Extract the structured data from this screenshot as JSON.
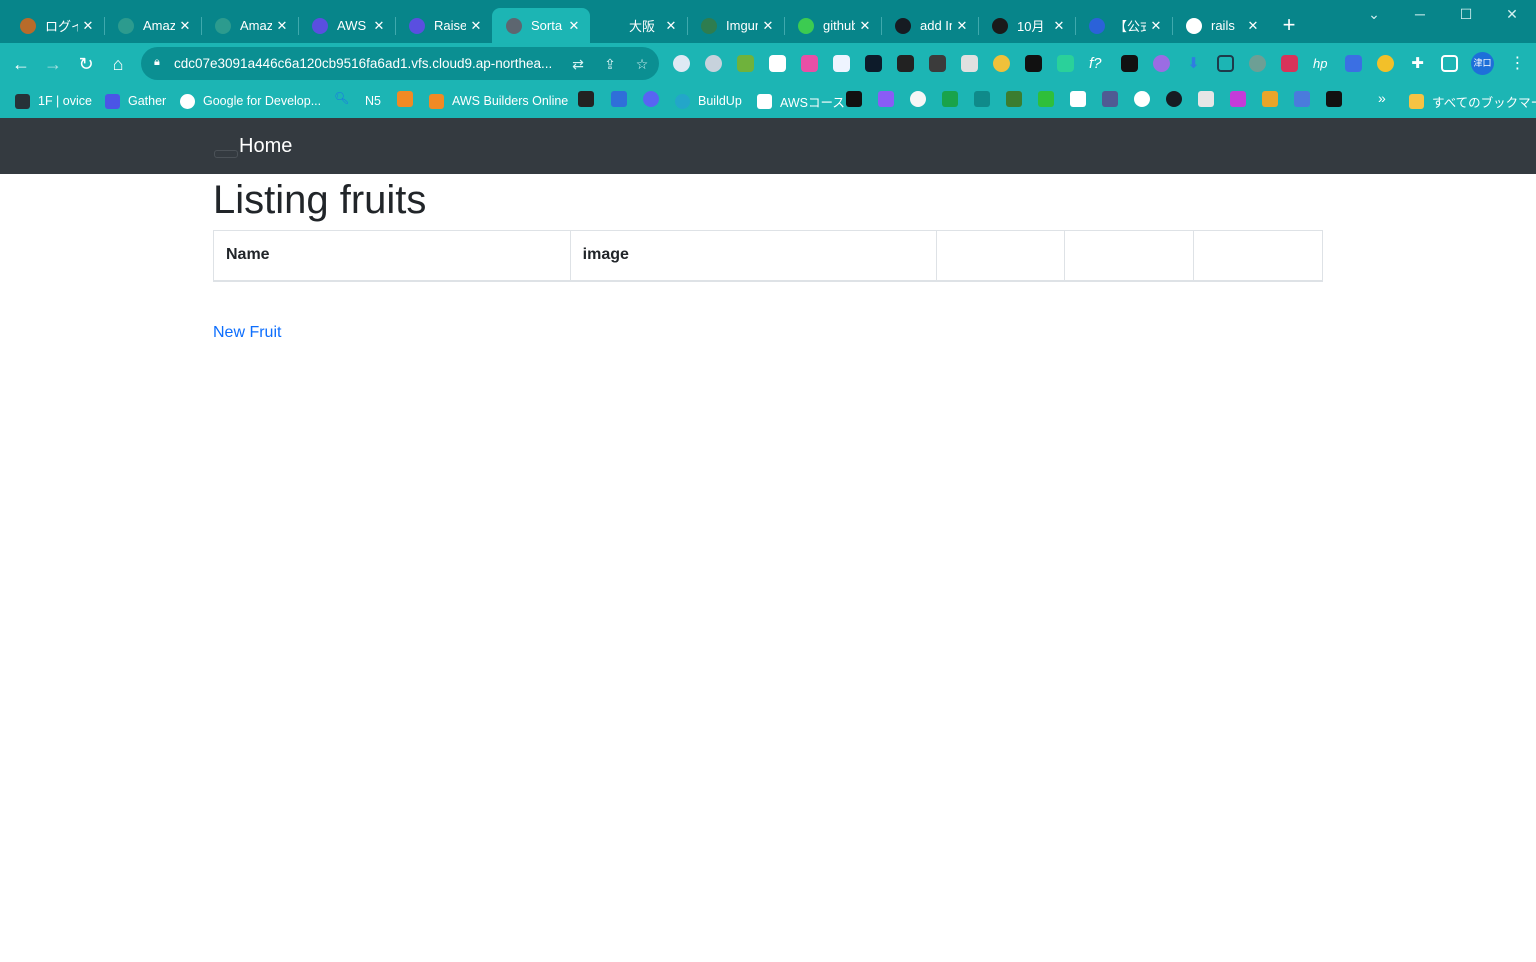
{
  "browser": {
    "tabs": [
      {
        "title": "ログイン",
        "favicon_color": "#b86b2a",
        "active": false
      },
      {
        "title": "Amazon",
        "favicon_color": "#2c9b8e",
        "active": false
      },
      {
        "title": "Amazon",
        "favicon_color": "#2c9b8e",
        "active": false
      },
      {
        "title": "AWS",
        "favicon_color": "#5a4fe0",
        "active": false
      },
      {
        "title": "Raise",
        "favicon_color": "#5a4fe0",
        "active": false
      },
      {
        "title": "Sorta",
        "favicon_color": "#5d6670",
        "active": true
      },
      {
        "title": "大阪",
        "favicon_color": "#ffffff",
        "active": false
      },
      {
        "title": "Imgur",
        "favicon_color": "#2e7d4f",
        "active": false
      },
      {
        "title": "github",
        "favicon_color": "#3ccb51",
        "active": false
      },
      {
        "title": "add Im",
        "favicon_color": "#161b22",
        "active": false
      },
      {
        "title": "10月",
        "favicon_color": "#1a1a1a",
        "active": false
      },
      {
        "title": "【公式",
        "favicon_color": "#2b62d9",
        "active": false
      },
      {
        "title": "rails",
        "favicon_color": "#ffffff",
        "active": false
      }
    ],
    "tab_close_glyph": "✕",
    "new_tab_glyph": "+",
    "url": "cdc07e3091a446c6a120cb9516fa6ad1.vfs.cloud9.ap-northea...",
    "profile_label": "津口",
    "bookmarks": [
      {
        "label": "1F | ovice",
        "color": "#263238"
      },
      {
        "label": "Gather",
        "color": "#4b55e6"
      },
      {
        "label": "Google for Develop...",
        "color": "#ffffff"
      },
      {
        "label": "N5",
        "color": "#1a73e8"
      },
      {
        "label": "AWS Builders Online",
        "color": "#f08a24"
      },
      {
        "label": "BuildUp",
        "color": "#23a6c9"
      },
      {
        "label": "AWSコース",
        "color": "#ffffff"
      }
    ],
    "bookmark_folder": "すべてのブックマーク",
    "more_glyph": "»"
  },
  "app": {
    "nav_home": "Home",
    "title": "Listing fruits",
    "table": {
      "headers": [
        "Name",
        "image",
        "",
        "",
        ""
      ]
    },
    "new_link": "New Fruit"
  }
}
